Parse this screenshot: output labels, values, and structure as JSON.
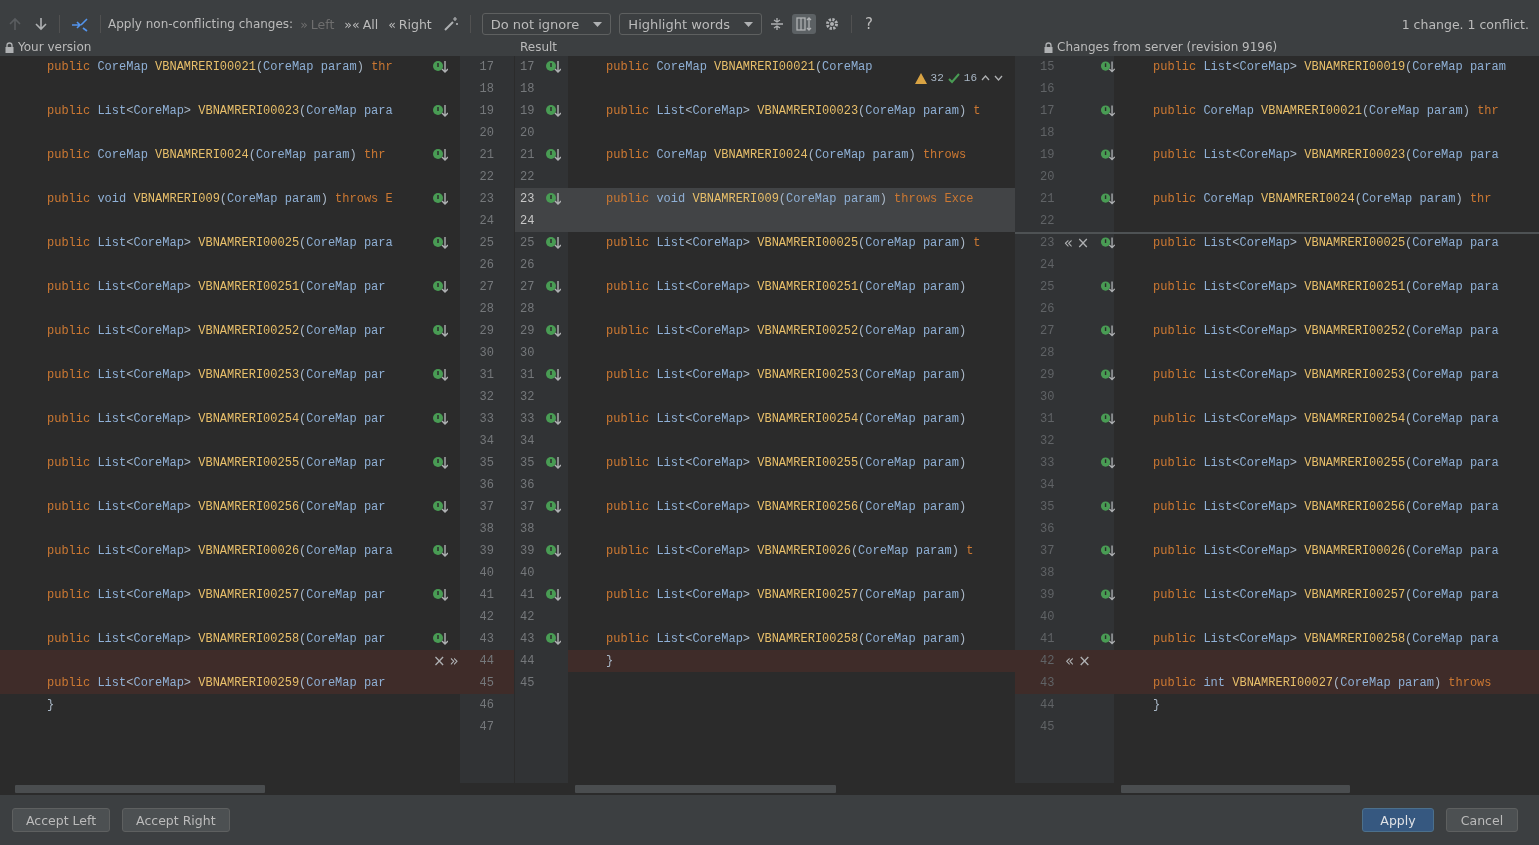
{
  "toolbar": {
    "nav": [
      {
        "kind": "up",
        "disabled": true
      },
      {
        "kind": "down",
        "disabled": false
      }
    ],
    "apply_label": "Apply non-conflicting changes:",
    "apply_buttons": [
      {
        "icon": "»",
        "label": "Left",
        "disabled": true
      },
      {
        "icon": "»«",
        "label": "All",
        "disabled": false
      },
      {
        "icon": "«",
        "label": "Right",
        "disabled": false
      }
    ],
    "ignore_dropdown": "Do not ignore",
    "highlight_dropdown": "Highlight words",
    "side_by_side_selected": true,
    "help": "?",
    "summary": "1 change. 1 conflict."
  },
  "panes": [
    {
      "title": "Your version",
      "locked": true
    },
    {
      "title": "Result",
      "locked": false
    },
    {
      "title": "Changes from server (revision 9196)",
      "locked": true
    }
  ],
  "inspection": {
    "warnings": "32",
    "ok": "16"
  },
  "left_lines": [
    {
      "n": "17",
      "code": "public CoreMap VBNAMRERI00021(CoreMap param) thr",
      "merge": true,
      "conflict": false
    },
    {
      "n": "18",
      "merge": false,
      "conflict": false
    },
    {
      "n": "19",
      "code": "public List<CoreMap> VBNAMRERI00023(CoreMap para",
      "merge": true,
      "conflict": false
    },
    {
      "n": "20",
      "merge": false,
      "conflict": false
    },
    {
      "n": "21",
      "code": "public CoreMap VBNAMRERI0024(CoreMap param) thr",
      "merge": true,
      "conflict": false
    },
    {
      "n": "22",
      "merge": false,
      "conflict": false
    },
    {
      "n": "23",
      "code": "public void VBNAMRERI009(CoreMap param) throws E",
      "merge": true,
      "conflict": false
    },
    {
      "n": "24",
      "merge": false,
      "conflict": false
    },
    {
      "n": "25",
      "code": "public List<CoreMap> VBNAMRERI00025(CoreMap para",
      "merge": true,
      "conflict": false
    },
    {
      "n": "26",
      "merge": false,
      "conflict": false
    },
    {
      "n": "27",
      "code": "public List<CoreMap> VBNAMRERI00251(CoreMap par",
      "merge": true,
      "conflict": false
    },
    {
      "n": "28",
      "merge": false,
      "conflict": false
    },
    {
      "n": "29",
      "code": "public List<CoreMap> VBNAMRERI00252(CoreMap par",
      "merge": true,
      "conflict": false
    },
    {
      "n": "30",
      "merge": false,
      "conflict": false
    },
    {
      "n": "31",
      "code": "public List<CoreMap> VBNAMRERI00253(CoreMap par",
      "merge": true,
      "conflict": false
    },
    {
      "n": "32",
      "merge": false,
      "conflict": false
    },
    {
      "n": "33",
      "code": "public List<CoreMap> VBNAMRERI00254(CoreMap par",
      "merge": true,
      "conflict": false
    },
    {
      "n": "34",
      "merge": false,
      "conflict": false
    },
    {
      "n": "35",
      "code": "public List<CoreMap> VBNAMRERI00255(CoreMap par",
      "merge": true,
      "conflict": false
    },
    {
      "n": "36",
      "merge": false,
      "conflict": false
    },
    {
      "n": "37",
      "code": "public List<CoreMap> VBNAMRERI00256(CoreMap par",
      "merge": true,
      "conflict": false
    },
    {
      "n": "38",
      "merge": false,
      "conflict": false
    },
    {
      "n": "39",
      "code": "public List<CoreMap> VBNAMRERI00026(CoreMap para",
      "merge": true,
      "conflict": false
    },
    {
      "n": "40",
      "merge": false,
      "conflict": false
    },
    {
      "n": "41",
      "code": "public List<CoreMap> VBNAMRERI00257(CoreMap par",
      "merge": true,
      "conflict": false
    },
    {
      "n": "42",
      "merge": false,
      "conflict": false
    },
    {
      "n": "43",
      "code": "public List<CoreMap> VBNAMRERI00258(CoreMap par",
      "merge": true,
      "conflict": false
    },
    {
      "n": "44",
      "merge": false,
      "conflict": true,
      "actions": [
        "×",
        "»"
      ]
    },
    {
      "n": "45",
      "code": "public List<CoreMap> VBNAMRERI00259(CoreMap par",
      "merge": false,
      "conflict": true
    },
    {
      "n": "46",
      "code": "}",
      "merge": false,
      "conflict": false
    },
    {
      "n": "47",
      "merge": false,
      "conflict": false
    }
  ],
  "result_lines": [
    {
      "n": "17",
      "code": "public CoreMap VBNAMRERI00021(CoreMap",
      "merge": true,
      "conflict": false,
      "current": false
    },
    {
      "n": "18",
      "merge": false,
      "conflict": false,
      "current": false
    },
    {
      "n": "19",
      "code": "public List<CoreMap> VBNAMRERI00023(CoreMap param) t",
      "merge": true,
      "conflict": false,
      "current": false
    },
    {
      "n": "20",
      "merge": false,
      "conflict": false,
      "current": false
    },
    {
      "n": "21",
      "code": "public CoreMap VBNAMRERI0024(CoreMap param) throws",
      "merge": true,
      "conflict": false,
      "current": false
    },
    {
      "n": "22",
      "merge": false,
      "conflict": false,
      "current": false
    },
    {
      "n": "23",
      "code": "public void VBNAMRERI009(CoreMap param) throws Exce",
      "merge": true,
      "conflict": false,
      "current": true
    },
    {
      "n": "24",
      "merge": false,
      "conflict": false,
      "current": true
    },
    {
      "n": "25",
      "code": "public List<CoreMap> VBNAMRERI00025(CoreMap param) t",
      "merge": true,
      "conflict": false,
      "current": false
    },
    {
      "n": "26",
      "merge": false,
      "conflict": false,
      "current": false
    },
    {
      "n": "27",
      "code": "public List<CoreMap> VBNAMRERI00251(CoreMap param)",
      "merge": true,
      "conflict": false,
      "current": false
    },
    {
      "n": "28",
      "merge": false,
      "conflict": false,
      "current": false
    },
    {
      "n": "29",
      "code": "public List<CoreMap> VBNAMRERI00252(CoreMap param)",
      "merge": true,
      "conflict": false,
      "current": false
    },
    {
      "n": "30",
      "merge": false,
      "conflict": false,
      "current": false
    },
    {
      "n": "31",
      "code": "public List<CoreMap> VBNAMRERI00253(CoreMap param)",
      "merge": true,
      "conflict": false,
      "current": false
    },
    {
      "n": "32",
      "merge": false,
      "conflict": false,
      "current": false
    },
    {
      "n": "33",
      "code": "public List<CoreMap> VBNAMRERI00254(CoreMap param)",
      "merge": true,
      "conflict": false,
      "current": false
    },
    {
      "n": "34",
      "merge": false,
      "conflict": false,
      "current": false
    },
    {
      "n": "35",
      "code": "public List<CoreMap> VBNAMRERI00255(CoreMap param)",
      "merge": true,
      "conflict": false,
      "current": false
    },
    {
      "n": "36",
      "merge": false,
      "conflict": false,
      "current": false
    },
    {
      "n": "37",
      "code": "public List<CoreMap> VBNAMRERI00256(CoreMap param)",
      "merge": true,
      "conflict": false,
      "current": false
    },
    {
      "n": "38",
      "merge": false,
      "conflict": false,
      "current": false
    },
    {
      "n": "39",
      "code": "public List<CoreMap> VBNAMRERI0026(CoreMap param) t",
      "merge": true,
      "conflict": false,
      "current": false
    },
    {
      "n": "40",
      "merge": false,
      "conflict": false,
      "current": false
    },
    {
      "n": "41",
      "code": "public List<CoreMap> VBNAMRERI00257(CoreMap param)",
      "merge": true,
      "conflict": false,
      "current": false
    },
    {
      "n": "42",
      "merge": false,
      "conflict": false,
      "current": false
    },
    {
      "n": "43",
      "code": "public List<CoreMap> VBNAMRERI00258(CoreMap param)",
      "merge": true,
      "conflict": false,
      "current": false
    },
    {
      "n": "44",
      "code": "}",
      "merge": false,
      "conflict": true,
      "current": false
    },
    {
      "n": "45",
      "merge": false,
      "conflict": false,
      "current": false
    }
  ],
  "right_lines": [
    {
      "n": "15",
      "code": "public List<CoreMap> VBNAMRERI00019(CoreMap param",
      "merge": true,
      "conflict": false
    },
    {
      "n": "16",
      "merge": false,
      "conflict": false
    },
    {
      "n": "17",
      "code": "public CoreMap VBNAMRERI00021(CoreMap param) thr",
      "merge": true,
      "conflict": false
    },
    {
      "n": "18",
      "merge": false,
      "conflict": false
    },
    {
      "n": "19",
      "code": "public List<CoreMap> VBNAMRERI00023(CoreMap para",
      "merge": true,
      "conflict": false
    },
    {
      "n": "20",
      "merge": false,
      "conflict": false
    },
    {
      "n": "21",
      "code": "public CoreMap VBNAMRERI0024(CoreMap param) thr",
      "merge": true,
      "conflict": false
    },
    {
      "n": "22",
      "merge": false,
      "conflict": false
    },
    {
      "n": "23",
      "code": "public List<CoreMap> VBNAMRERI00025(CoreMap para",
      "merge": true,
      "conflict": false,
      "actions": [
        "«",
        "×"
      ]
    },
    {
      "n": "24",
      "merge": false,
      "conflict": false
    },
    {
      "n": "25",
      "code": "public List<CoreMap> VBNAMRERI00251(CoreMap para",
      "merge": true,
      "conflict": false
    },
    {
      "n": "26",
      "merge": false,
      "conflict": false
    },
    {
      "n": "27",
      "code": "public List<CoreMap> VBNAMRERI00252(CoreMap para",
      "merge": true,
      "conflict": false
    },
    {
      "n": "28",
      "merge": false,
      "conflict": false
    },
    {
      "n": "29",
      "code": "public List<CoreMap> VBNAMRERI00253(CoreMap para",
      "merge": true,
      "conflict": false
    },
    {
      "n": "30",
      "merge": false,
      "conflict": false
    },
    {
      "n": "31",
      "code": "public List<CoreMap> VBNAMRERI00254(CoreMap para",
      "merge": true,
      "conflict": false
    },
    {
      "n": "32",
      "merge": false,
      "conflict": false
    },
    {
      "n": "33",
      "code": "public List<CoreMap> VBNAMRERI00255(CoreMap para",
      "merge": true,
      "conflict": false
    },
    {
      "n": "34",
      "merge": false,
      "conflict": false
    },
    {
      "n": "35",
      "code": "public List<CoreMap> VBNAMRERI00256(CoreMap para",
      "merge": true,
      "conflict": false
    },
    {
      "n": "36",
      "merge": false,
      "conflict": false
    },
    {
      "n": "37",
      "code": "public List<CoreMap> VBNAMRERI00026(CoreMap para",
      "merge": true,
      "conflict": false
    },
    {
      "n": "38",
      "merge": false,
      "conflict": false
    },
    {
      "n": "39",
      "code": "public List<CoreMap> VBNAMRERI00257(CoreMap para",
      "merge": true,
      "conflict": false
    },
    {
      "n": "40",
      "merge": false,
      "conflict": false
    },
    {
      "n": "41",
      "code": "public List<CoreMap> VBNAMRERI00258(CoreMap para",
      "merge": true,
      "conflict": false
    },
    {
      "n": "42",
      "merge": false,
      "conflict": true,
      "actions": [
        "«",
        "×"
      ]
    },
    {
      "n": "43",
      "code": "public int VBNAMRERI00027(CoreMap param) throws",
      "merge": false,
      "conflict": true
    },
    {
      "n": "44",
      "code": "}",
      "merge": false,
      "conflict": false
    },
    {
      "n": "45",
      "merge": false,
      "conflict": false
    }
  ],
  "buttons": [
    {
      "label": "Accept Left",
      "kind": "secondary"
    },
    {
      "label": "Accept Right",
      "kind": "secondary"
    },
    {
      "label": "Apply",
      "kind": "primary"
    },
    {
      "label": "Cancel",
      "kind": "secondary"
    }
  ]
}
